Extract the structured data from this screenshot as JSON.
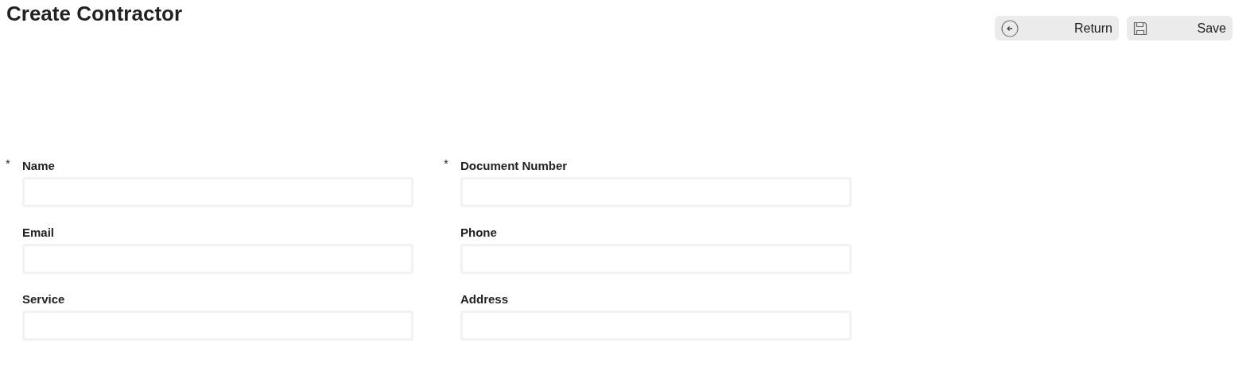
{
  "title": "Create Contractor",
  "buttons": [
    {
      "kind": "return",
      "label": "Return"
    },
    {
      "kind": "save",
      "label": "Save"
    }
  ],
  "fields": [
    {
      "label": "Name",
      "required_mark": "*"
    },
    {
      "label": "Document Number",
      "required_mark": "*"
    },
    {
      "label": "Email"
    },
    {
      "label": "Phone"
    },
    {
      "label": "Service"
    },
    {
      "label": "Address"
    }
  ]
}
